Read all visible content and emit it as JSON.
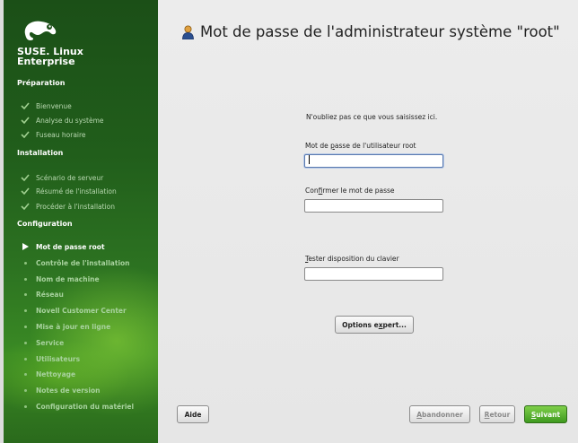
{
  "sidebar": {
    "brand_line1": "SUSE. Linux",
    "brand_line2": "Enterprise",
    "sections": [
      {
        "label": "Préparation"
      },
      {
        "label": "Installation"
      },
      {
        "label": "Configuration"
      }
    ],
    "items": [
      {
        "label": "Bienvenue",
        "state": "done"
      },
      {
        "label": "Analyse du système",
        "state": "done"
      },
      {
        "label": "Fuseau horaire",
        "state": "done"
      },
      {
        "label": "Scénario de serveur",
        "state": "done"
      },
      {
        "label": "Résumé de l'installation",
        "state": "done"
      },
      {
        "label": "Procéder à l'installation",
        "state": "done"
      },
      {
        "label": "Mot de passe root",
        "state": "current"
      },
      {
        "label": "Contrôle de l'installation",
        "state": "todo"
      },
      {
        "label": "Nom de machine",
        "state": "todo"
      },
      {
        "label": "Réseau",
        "state": "todo"
      },
      {
        "label": "Novell Customer Center",
        "state": "todo"
      },
      {
        "label": "Mise à jour en ligne",
        "state": "todo"
      },
      {
        "label": "Service",
        "state": "todo"
      },
      {
        "label": "Utilisateurs",
        "state": "todo"
      },
      {
        "label": "Nettoyage",
        "state": "todo"
      },
      {
        "label": "Notes de version",
        "state": "todo"
      },
      {
        "label": "Configuration du matériel",
        "state": "todo"
      }
    ]
  },
  "main": {
    "title": "Mot de passe de l'administrateur système \"root\"",
    "hint": "N'oubliez pas ce que vous saisissez ici.",
    "password_label": "Mot de passe de l'utilisateur root",
    "password_value": "",
    "confirm_label": "Confirmer le mot de passe",
    "confirm_value": "",
    "keyboard_label": "Tester disposition du clavier",
    "keyboard_value": "",
    "expert_button": "Options expert..."
  },
  "footer": {
    "help": "Aide",
    "abort": "Abandonner",
    "back": "Retour",
    "next": "Suivant"
  },
  "colors": {
    "sidebar_dark": "#1b4f17",
    "sidebar_light": "#3a8a24",
    "primary_button": "#4fae27"
  }
}
